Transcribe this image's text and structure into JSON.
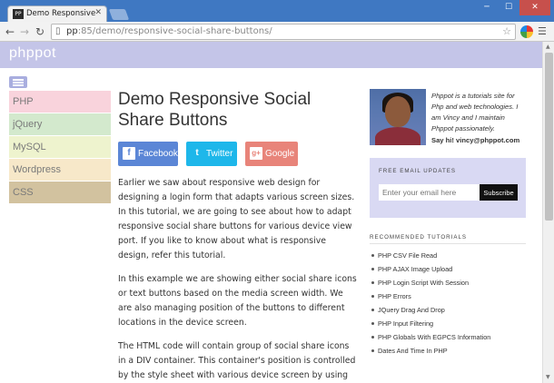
{
  "browser": {
    "tab_title": "Demo Responsive Social S",
    "tab_favicon_text": "PP",
    "url_host": "pp",
    "url_rest": ":85/demo/responsive-social-share-buttons/",
    "icons": {
      "back": "arrow-left-icon",
      "forward": "arrow-right-icon",
      "reload": "reload-icon",
      "page": "page-icon",
      "star": "star-icon",
      "extension": "extension-icon",
      "menu": "hamburger-menu-icon"
    }
  },
  "site": {
    "logo": "phppot",
    "header_color": "#c4c5e8"
  },
  "menu": {
    "items": [
      {
        "label": "PHP",
        "color": "#f9d3dc"
      },
      {
        "label": "jQuery",
        "color": "#d3e9cd"
      },
      {
        "label": "MySQL",
        "color": "#eef3ce"
      },
      {
        "label": "Wordpress",
        "color": "#f7e8c9"
      },
      {
        "label": "CSS",
        "color": "#d2c29f"
      }
    ]
  },
  "main": {
    "title": "Demo Responsive Social Share Buttons",
    "share_buttons": [
      {
        "label": "Facebook",
        "icon_glyph": "f",
        "color": "#5b86d6"
      },
      {
        "label": "Twitter",
        "icon_glyph": "t",
        "color": "#1eb7ea"
      },
      {
        "label": "Google",
        "icon_glyph": "g+",
        "color": "#e8847a"
      }
    ],
    "paragraphs": [
      "Earlier we saw about responsive web design for designing a login form that adapts various screen sizes. In this tutorial, we are going to see about how to adapt responsive social share buttons for various device view port. If you like to know about what is responsive design, refer this tutorial.",
      "In this example we are showing either social share icons or text buttons based on the media screen width. We are also managing position of the buttons to different locations in the device screen.",
      "The HTML code will contain group of social share icons in a DIV container. This container's position is controlled by the style sheet with various device screen by using medial queries."
    ]
  },
  "sidebar": {
    "profile_text": "Phppot is a tutorials site for Php and web technologies. I am Vincy and I maintain Phppot passionately.",
    "say_hi": "Say hi! vincy@phppot.com",
    "email_title": "FREE EMAIL UPDATES",
    "email_placeholder": "Enter your email here",
    "subscribe_label": "Subscribe",
    "recommended_title": "RECOMMENDED TUTORIALS",
    "recommended": [
      "PHP CSV File Read",
      "PHP AJAX Image Upload",
      "PHP Login Script With Session",
      "PHP Errors",
      "JQuery Drag And Drop",
      "PHP Input Filtering",
      "PHP Globals With EGPCS Information",
      "Dates And Time In PHP"
    ]
  }
}
